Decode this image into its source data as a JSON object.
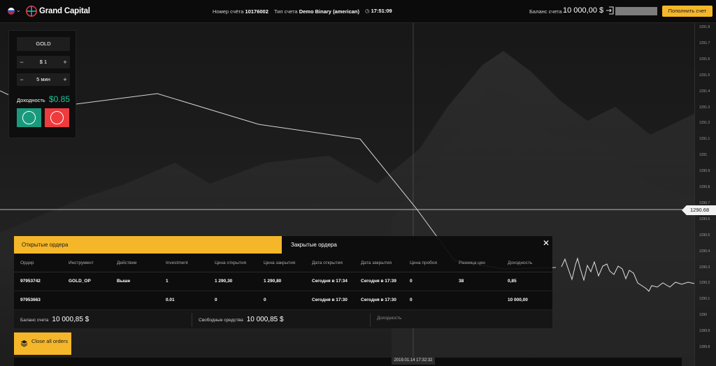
{
  "topbar": {
    "logo": "Grand Capital",
    "account_label": "Номер счёта",
    "account_number": "10176002",
    "account_type_label": "Тип счета",
    "account_type": "Demo Binary",
    "account_type_suffix": "(american)",
    "clock": "17:51:09",
    "balance_label": "Баланс счета",
    "balance_value": "10 000,00 $",
    "deposit_button": "Пополнить счет"
  },
  "trade": {
    "asset": "GOLD",
    "amount": "$ 1",
    "duration": "5 мин",
    "minus": "−",
    "plus": "+",
    "yield_label": "Доходность",
    "yield_value": "$0.85"
  },
  "chart": {
    "current_price": "1290.68",
    "cursor_time": "2019.01.14 17:32:32",
    "price_ticks": [
      "1291.8",
      "1291.7",
      "1291.6",
      "1291.5",
      "1291.4",
      "1291.3",
      "1291.2",
      "1291.1",
      "1291",
      "1290.9",
      "1290.8",
      "1290.7",
      "1290.6",
      "1290.5",
      "1290.4",
      "1290.3",
      "1290.2",
      "1290.1",
      "1290",
      "1289.9",
      "1289.8"
    ]
  },
  "orders": {
    "tab_open": "Открытые ордера",
    "tab_closed": "Закрытые ордера",
    "close_symbol": "✕",
    "columns": [
      "Ордер",
      "Инструмент",
      "Действие",
      "Investment",
      "Цена открытия",
      "Цена закрытия",
      "Дата открытия",
      "Дата закрытия",
      "Цена пробоя",
      "Разница цен",
      "Доходность"
    ],
    "rows": [
      [
        "97953742",
        "GOLD_OP",
        "Выше",
        "1",
        "1 290,30",
        "1 290,80",
        "Сегодня в 17:34",
        "Сегодня в 17:39",
        "0",
        "38",
        "0,85"
      ],
      [
        "97953663",
        "",
        "",
        "0.01",
        "0",
        "0",
        "Сегодня в 17:30",
        "Сегодня в 17:30",
        "0",
        "",
        "10 000,00"
      ]
    ],
    "footer": {
      "balance_label": "Баланс счета",
      "balance_value": "10 000,85 $",
      "free_label": "Свободные средства",
      "free_value": "10 000,85 $",
      "yield_label": "Доходность"
    },
    "close_all": "Close all orders"
  },
  "colors": {
    "accent": "#f5b729",
    "up": "#1a9a7d",
    "down": "#ee3b3e",
    "yield": "#1cc79a"
  }
}
